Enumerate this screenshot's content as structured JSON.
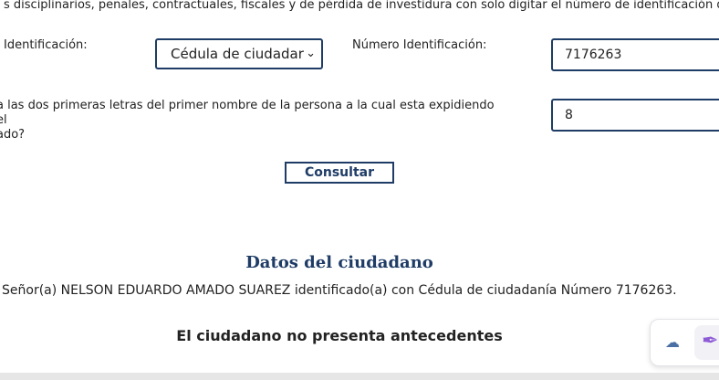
{
  "intro_text": "s disciplinarios, penales, contractuales, fiscales y de pérdida de investidura con solo digitar el número de identificación de la",
  "form": {
    "id_type_label": "Identificación:",
    "id_type_selected": "Cédula de ciudadar",
    "id_number_label": "Número Identificación:",
    "id_number_value": "7176263",
    "question_line1": "a las dos primeras letras del primer nombre de la persona a la cual esta expidiendo el",
    "question_line2": "ado?",
    "answer_value": "8",
    "submit_label": "Consultar"
  },
  "result": {
    "heading": "Datos del ciudadano",
    "citizen_line": "Señor(a)  NELSON EDUARDO AMADO SUAREZ identificado(a) con Cédula de ciudadanía Número 7176263.",
    "status": "El ciudadano no presenta antecedentes"
  },
  "icons": {
    "select_chevron": "chevron-down-icon",
    "cloud": "cloud-icon",
    "pen": "pen-icon"
  },
  "colors": {
    "accent": "#1f3c66",
    "pen": "#8e5bd6"
  }
}
